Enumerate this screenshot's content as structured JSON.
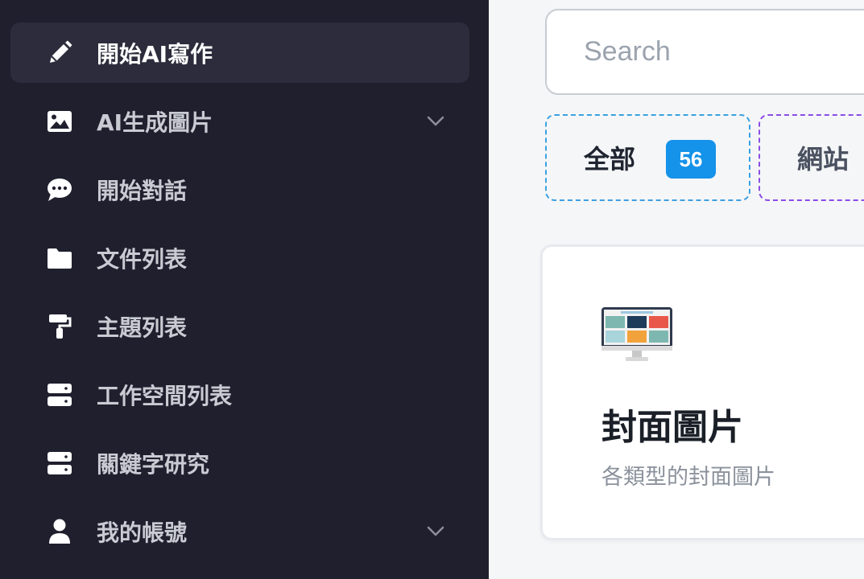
{
  "sidebar": {
    "items": [
      {
        "label": "開始AI寫作",
        "icon": "pencil-icon",
        "active": true
      },
      {
        "label": "AI生成圖片",
        "icon": "image-icon",
        "has_submenu": true
      },
      {
        "label": "開始對話",
        "icon": "chat-bubble-icon"
      },
      {
        "label": "文件列表",
        "icon": "folder-icon"
      },
      {
        "label": "主題列表",
        "icon": "paint-roller-icon"
      },
      {
        "label": "工作空間列表",
        "icon": "server-icon"
      },
      {
        "label": "關鍵字研究",
        "icon": "server-icon"
      },
      {
        "label": "我的帳號",
        "icon": "user-icon",
        "has_submenu": true
      }
    ]
  },
  "main": {
    "search": {
      "placeholder": "Search"
    },
    "filters": [
      {
        "label": "全部",
        "count": "56"
      },
      {
        "label": "網站"
      }
    ],
    "cards": [
      {
        "title": "封面圖片",
        "description": "各類型的封面圖片",
        "icon": "monitor-icon"
      }
    ]
  },
  "colors": {
    "sidebar_bg": "#1f1f2e",
    "active_item_bg": "#2c2c3c",
    "badge_blue": "#1592e9",
    "filter_all_border": "#3aa0e0",
    "filter_web_border": "#8a4ce6"
  }
}
